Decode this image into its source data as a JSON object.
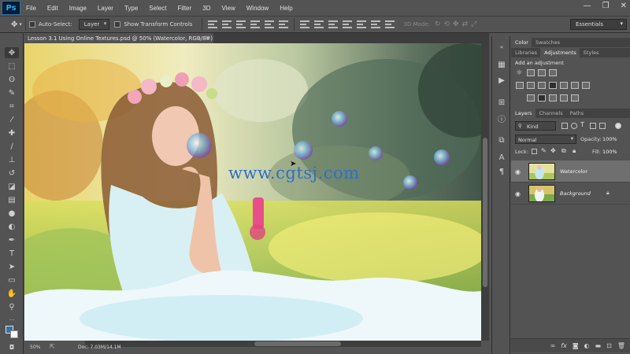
{
  "app": {
    "logo": "Ps",
    "menu": [
      "File",
      "Edit",
      "Image",
      "Layer",
      "Type",
      "Select",
      "Filter",
      "3D",
      "View",
      "Window",
      "Help"
    ]
  },
  "options": {
    "auto_select_label": "Auto-Select:",
    "auto_select_value": "Layer",
    "transform_label": "Show Transform Controls",
    "mode_3d": "3D Mode:",
    "workspace": "Essentials"
  },
  "document": {
    "tab_title": "Lesson 3.1 Using Online Textures.psd @ 50% (Watercolor, RGB/8#)",
    "watermark": "www.cgtsj.com"
  },
  "status": {
    "zoom": "50%",
    "doc_info": "Doc: 7.03M/14.1M"
  },
  "panels": {
    "top_tabs": [
      "Color",
      "Swatches"
    ],
    "mid_tabs": [
      "Libraries",
      "Adjustments",
      "Styles"
    ],
    "adjustments_title": "Add an adjustment",
    "layer_tabs": [
      "Layers",
      "Channels",
      "Paths"
    ],
    "filter_kind": "Kind",
    "blend_mode": "Normal",
    "opacity_label": "Opacity:",
    "opacity_value": "100%",
    "lock_label": "Lock:",
    "fill_label": "Fill:",
    "fill_value": "100%",
    "layers": [
      {
        "name": "Watercolor",
        "selected": true,
        "locked": false
      },
      {
        "name": "Background",
        "selected": false,
        "locked": true
      }
    ]
  },
  "colors": {
    "ui_background": "#535353",
    "dark_panel": "#424242",
    "selected_layer": "#6f6f6f",
    "watermark": "#2e6fc9"
  }
}
